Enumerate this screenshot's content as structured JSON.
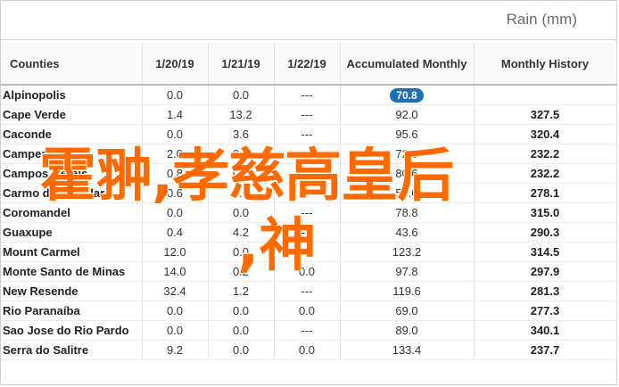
{
  "header": {
    "title": "Rain (mm)"
  },
  "table": {
    "columns": [
      "Counties",
      "1/20/19",
      "1/21/19",
      "1/22/19",
      "Accumulated Monthly",
      "Monthly History"
    ],
    "rows": [
      {
        "county": "Alpinopolis",
        "d1": "0.0",
        "d2": "0.0",
        "d3": "---",
        "acc": "70.8",
        "hist": ""
      },
      {
        "county": "Cape Verde",
        "d1": "1.4",
        "d2": "13.2",
        "d3": "---",
        "acc": "92.0",
        "hist": "327.5"
      },
      {
        "county": "Caconde",
        "d1": "0.0",
        "d2": "3.6",
        "d3": "---",
        "acc": "95.6",
        "hist": "320.4"
      },
      {
        "county": "Campestre",
        "d1": "2.0",
        "d2": "0.2",
        "d3": "---",
        "acc": "72.0",
        "hist": "232.2"
      },
      {
        "county": "Campos Gerais",
        "d1": "0.8",
        "d2": "0.0",
        "d3": "---",
        "acc": "80.6",
        "hist": "232.2"
      },
      {
        "county": "Carmo do Rio Claro",
        "d1": "0.6",
        "d2": "0.0",
        "d3": "---",
        "acc": "58.0",
        "hist": "278.1"
      },
      {
        "county": "Coromandel",
        "d1": "0.0",
        "d2": "0.0",
        "d3": "---",
        "acc": "78.8",
        "hist": "315.0"
      },
      {
        "county": "Guaxupe",
        "d1": "0.4",
        "d2": "4.2",
        "d3": "---",
        "acc": "43.6",
        "hist": "290.3"
      },
      {
        "county": "Mount Carmel",
        "d1": "12.0",
        "d2": "0.0",
        "d3": "---",
        "acc": "123.2",
        "hist": "314.5"
      },
      {
        "county": "Monte Santo de Minas",
        "d1": "14.0",
        "d2": "0.2",
        "d3": "0.0",
        "acc": "97.8",
        "hist": "297.9"
      },
      {
        "county": "New Resende",
        "d1": "32.4",
        "d2": "1.2",
        "d3": "---",
        "acc": "119.6",
        "hist": "281.3"
      },
      {
        "county": "Rio Paranaíba",
        "d1": "0.0",
        "d2": "0.0",
        "d3": "0.0",
        "acc": "69.0",
        "hist": "277.3"
      },
      {
        "county": "Sao Jose do Rio Pardo",
        "d1": "0.0",
        "d2": "0.0",
        "d3": "---",
        "acc": "89.0",
        "hist": "340.1"
      },
      {
        "county": "Serra do Salitre",
        "d1": "9.2",
        "d2": "0.0",
        "d3": "0.0",
        "acc": "133.4",
        "hist": "237.7"
      }
    ]
  },
  "overlay": {
    "line1": "霍翀,孝慈高皇后",
    "line2": ",神"
  },
  "colors": {
    "accent": "#1f6fb5",
    "overlay": "#ff6a00"
  }
}
